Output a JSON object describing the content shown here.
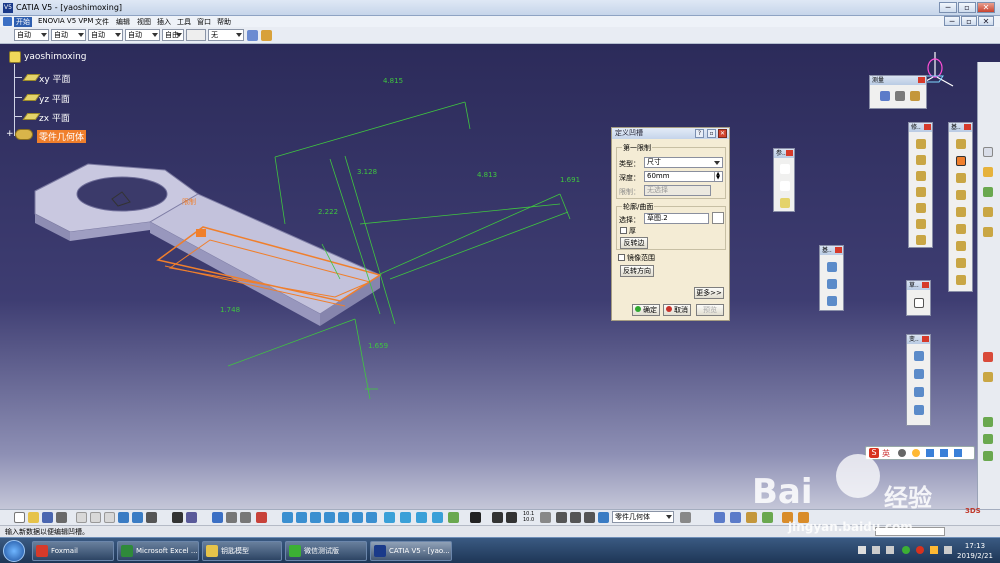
{
  "window": {
    "title": "CATIA V5 - [yaoshimoxing]",
    "logo_text": "V5",
    "minimize_glyph": "─",
    "restore_glyph": "▫",
    "close_glyph": "✕",
    "inner_minimize": "─",
    "inner_restore": "▫",
    "inner_close": "✕"
  },
  "menu": [
    "开始",
    "ENOVIA V5 VPM",
    "文件",
    "编辑",
    "视图",
    "插入",
    "工具",
    "窗口",
    "帮助"
  ],
  "toolbar1": {
    "combos": [
      "自动",
      "自动",
      "自动",
      "自动",
      "自由",
      "无"
    ],
    "small_combo": "",
    "spinner": ""
  },
  "tree": {
    "root": "yaoshimoxing",
    "items": [
      "xy 平面",
      "yz 平面",
      "zx 平面"
    ],
    "selected": "零件几何体"
  },
  "dimensions": [
    "4.815",
    "3.128",
    "4.813",
    "1.691",
    "2.222",
    "1.748",
    "1.659"
  ],
  "model_label": "限制",
  "dialog": {
    "title": "定义凹槽",
    "help_glyph": "?",
    "restore_glyph": "▫",
    "close_glyph": "✕",
    "section1": "第一限制",
    "type_label": "类型：",
    "type_value": "尺寸",
    "depth_label": "深度：",
    "depth_value": "60mm",
    "limit_label": "限制：",
    "limit_value": "无选择",
    "section2": "轮廓/曲面",
    "select_label": "选择：",
    "select_value": "草图.2",
    "thick": "厚",
    "reverse_side": "反转边",
    "mirror": "镜像范围",
    "reverse_dir": "反转方向",
    "more": "更多>>",
    "ok": "确定",
    "cancel": "取消",
    "preview": "预览"
  },
  "palettes": {
    "measure": "测量",
    "p2": "参..",
    "p3": "修..",
    "p4": "基..",
    "p5": "基..",
    "p6": "草..",
    "p7": "变.."
  },
  "bottombar": {
    "combo": "零件几何体",
    "zoom_top": "10.1",
    "zoom_bottom": "10.0"
  },
  "status": {
    "message": "输入新数据以便编辑凹槽。"
  },
  "taskbar": {
    "items": [
      "Foxmail",
      "Microsoft Excel ...",
      "钥匙模型",
      "微信测试版",
      "CATIA V5 - [yao..."
    ],
    "time": "17:13",
    "date": "2019/2/21"
  },
  "ime": {
    "mode": "英",
    "text": "S"
  },
  "watermark": {
    "brand": "Bai",
    "suffix": "经验",
    "url": "jingyan.baidu.com"
  },
  "colors": {
    "viewport_top": "#2c2b5a",
    "selection_orange": "#f07f2c",
    "dimension_green": "#3fc63f",
    "dialog_bg": "#f4ecd5"
  }
}
